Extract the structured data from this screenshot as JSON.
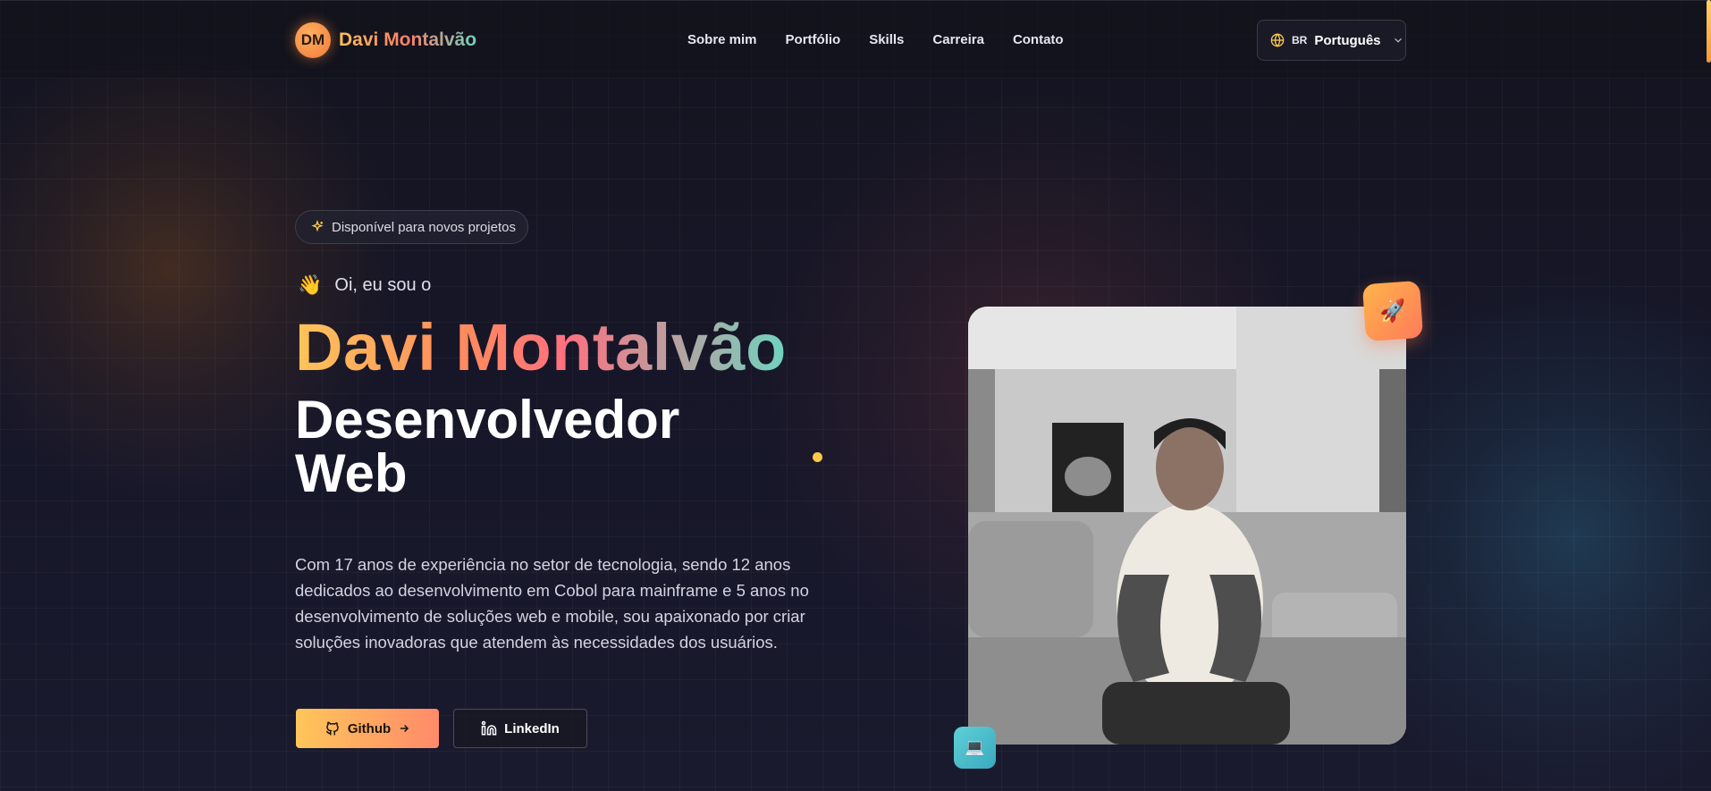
{
  "header": {
    "logo_initials": "DM",
    "brand_name": "Davi Montalvão",
    "nav": [
      {
        "label": "Sobre mim"
      },
      {
        "label": "Portfólio"
      },
      {
        "label": "Skills"
      },
      {
        "label": "Carreira"
      },
      {
        "label": "Contato"
      }
    ],
    "language": {
      "flag": "BR",
      "label": "Português"
    }
  },
  "hero": {
    "availability": "Disponível para novos projetos",
    "greeting_emoji": "👋",
    "greeting": "Oi, eu sou o",
    "name": "Davi Montalvão",
    "role": "Desenvolvedor Web",
    "description": "Com 17 anos de experiência no setor de tecnologia, sendo 12 anos dedicados ao desenvolvimento em Cobol para mainframe e 5 anos no desenvolvimento de soluções web e mobile, sou apaixonado por criar soluções inovadoras que atendem às necessidades dos usuários.",
    "buttons": {
      "github": "Github",
      "linkedin": "LinkedIn"
    },
    "rocket_emoji": "🚀",
    "laptop_emoji": "💻"
  },
  "colors": {
    "accent_gradient_start": "#ffc45a",
    "accent_gradient_mid": "#ff7080",
    "accent_gradient_end": "#6fd3c0",
    "background": "#14141f"
  }
}
